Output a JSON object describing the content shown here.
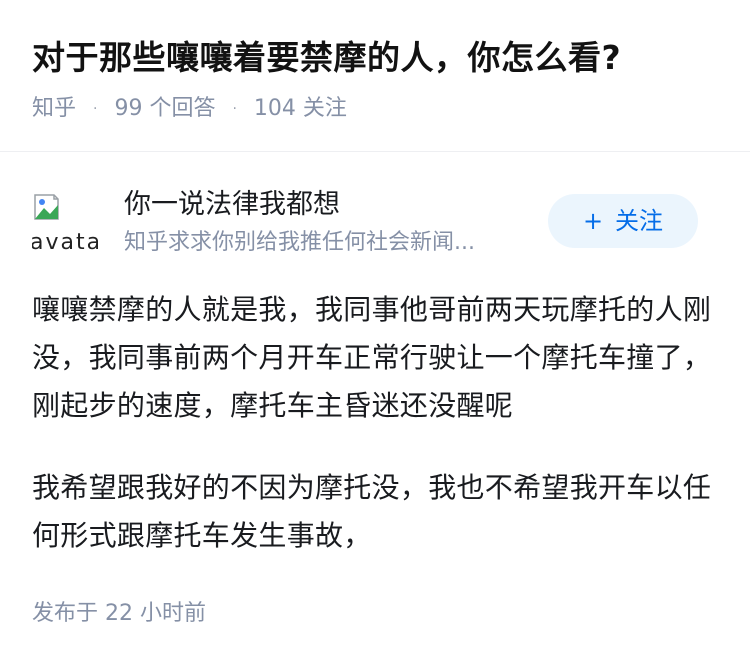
{
  "question": {
    "title": "对于那些嚷嚷着要禁摩的人，你怎么看?",
    "source": "知乎",
    "separator": "·",
    "answers": "99 个回答",
    "followers": "104 关注"
  },
  "author": {
    "name": "你一说法律我都想",
    "bio": "知乎求求你别给我推任何社会新闻...",
    "avatar_alt": "avatar",
    "avatar_icon": "broken-image-icon",
    "follow_label": "关注",
    "follow_icon": "plus-icon"
  },
  "answer": {
    "paragraphs": [
      "嚷嚷禁摩的人就是我，我同事他哥前两天玩摩托的人刚没，我同事前两个月开车正常行驶让一个摩托车撞了，刚起步的速度，摩托车主昏迷还没醒呢",
      "我希望跟我好的不因为摩托没，我也不希望我开车以任何形式跟摩托车发生事故，"
    ]
  },
  "footer": {
    "published": "发布于  22 小时前"
  },
  "colors": {
    "accent": "#056de8",
    "button_bg": "#ebf5fd",
    "meta_text": "#8590a6",
    "body_text": "#191b1f"
  }
}
